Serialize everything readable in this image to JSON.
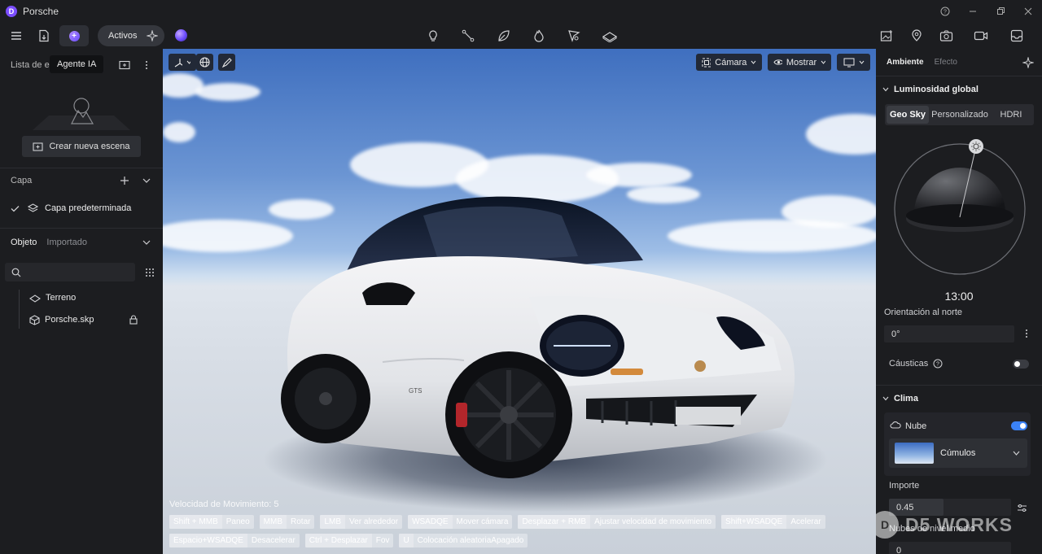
{
  "app": {
    "title": "Porsche",
    "logo_letter": "D"
  },
  "toolbar": {
    "assets_label": "Activos",
    "tooltip": "Agente IA"
  },
  "left_panel": {
    "scene_list_label": "Lista de e",
    "create_scene_label": "Crear nueva escena",
    "layer_label": "Capa",
    "default_layer_label": "Capa predeterminada",
    "tabs": [
      "Objeto",
      "Importado"
    ],
    "search": {
      "value": "",
      "placeholder": ""
    },
    "tree": [
      {
        "label": "Terreno",
        "icon": "terrain-icon"
      },
      {
        "label": "Porsche.skp",
        "icon": "model-icon"
      }
    ]
  },
  "viewport": {
    "camera_label": "Cámara",
    "show_label": "Mostrar",
    "speed_label": "Velocidad de Movimiento: 5",
    "hints_row1": [
      {
        "key": "Shift + MMB",
        "action": "Paneo"
      },
      {
        "key": "MMB",
        "action": "Rotar"
      },
      {
        "key": "LMB",
        "action": "Ver alrededor"
      },
      {
        "key": "WSADQE",
        "action": "Mover cámara"
      },
      {
        "key": "Desplazar + RMB",
        "action": "Ajustar velocidad de movimiento"
      },
      {
        "key": "Shift+WSADQE",
        "action": "Acelerar"
      }
    ],
    "hints_row2": [
      {
        "key": "Espacio+WSADQE",
        "action": "Desacelerar"
      },
      {
        "key": "Ctrl + Desplazar",
        "action": "Fov"
      },
      {
        "key": "U",
        "action": "Colocación aleatoriaApagado"
      }
    ],
    "car_badge": "GTS"
  },
  "right_panel": {
    "tabs": [
      "Ambiente",
      "Efecto"
    ],
    "global_light_title": "Luminosidad global",
    "sky_modes": [
      "Geo Sky",
      "Personalizado",
      "HDRI"
    ],
    "sky_mode_selected": "Geo Sky",
    "time": "13:00",
    "north_label": "Orientación al norte",
    "north_value": "0°",
    "caustics_label": "Cáusticas",
    "caustics_on": false,
    "climate_title": "Clima",
    "cloud_label": "Nube",
    "cloud_on": true,
    "cloud_type": "Cúmulos",
    "amount_label": "Importe",
    "amount_value": "0.45",
    "mid_clouds_label": "Nubes de nivel medio",
    "mid_clouds_value": "0",
    "watermark": "D5 WORKS",
    "accent": "#3b82f6"
  }
}
